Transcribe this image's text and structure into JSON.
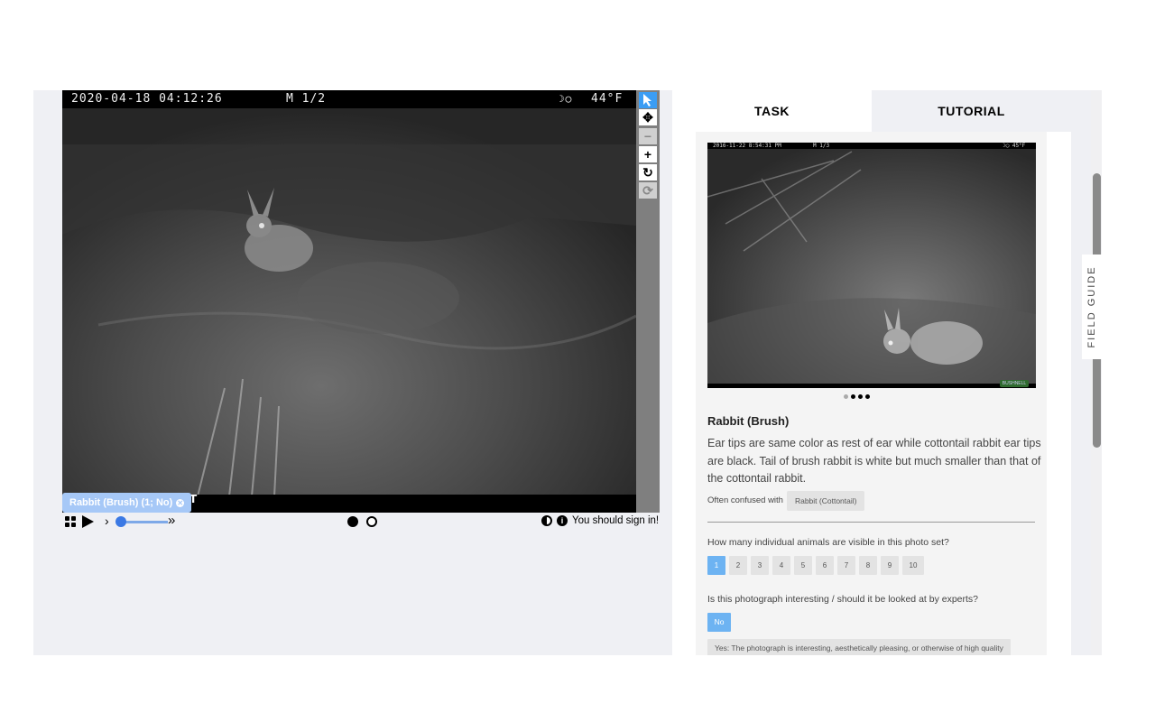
{
  "viewer": {
    "camera": {
      "timestamp": "2020-04-18 04:12:26",
      "mode": "M 1/2",
      "moon": "☽◯",
      "temperature": "44°F"
    },
    "bottom_char": "T",
    "mark_tag": "Rabbit (Brush) (1; No)",
    "tools": [
      "pointer-icon",
      "move-icon",
      "zoom-out-icon",
      "zoom-in-icon",
      "rotate-icon",
      "reset-icon"
    ],
    "controls": {
      "chevron": "›",
      "forward": "»",
      "sign_in": "You should sign in!"
    }
  },
  "panel": {
    "tabs": {
      "task": "TASK",
      "tutorial": "TUTORIAL"
    },
    "example_photo": {
      "timestamp": "2016-11-22 8:54:31 PM",
      "mode": "M 1/3",
      "temp": "☽◯ 45°F",
      "brand": "BUSHNELL"
    },
    "species": "Rabbit (Brush)",
    "description": "Ear tips are same color as rest of ear while cottontail rabbit ear tips are black. Tail of brush rabbit is white but much smaller than that of the cottontail rabbit.",
    "confused_label": "Often confused with",
    "confused_with": "Rabbit (Cottontail)",
    "question_count": "How many individual animals are visible in this photo set?",
    "count_options": [
      "1",
      "2",
      "3",
      "4",
      "5",
      "6",
      "7",
      "8",
      "9",
      "10"
    ],
    "count_selected": "1",
    "question_interesting": "Is this photograph interesting / should it be looked at by experts?",
    "no_label": "No",
    "yes_label": "Yes: The photograph is interesting, aesthetically pleasing, or otherwise of high quality"
  },
  "field_guide": "FIELD GUIDE",
  "colors": {
    "accent": "#3b9df4",
    "selected": "#6db3f2",
    "tag": "#a6c8f7"
  }
}
